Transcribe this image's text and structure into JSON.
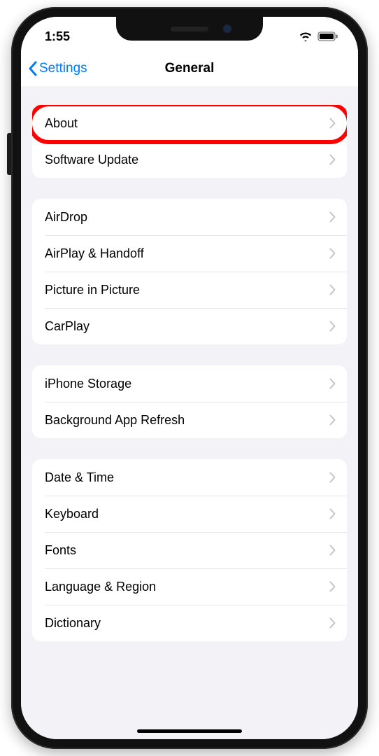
{
  "status": {
    "time": "1:55"
  },
  "nav": {
    "back_label": "Settings",
    "title": "General"
  },
  "groups": [
    {
      "items": [
        {
          "label": "About",
          "highlighted": true
        },
        {
          "label": "Software Update"
        }
      ]
    },
    {
      "items": [
        {
          "label": "AirDrop"
        },
        {
          "label": "AirPlay & Handoff"
        },
        {
          "label": "Picture in Picture"
        },
        {
          "label": "CarPlay"
        }
      ]
    },
    {
      "items": [
        {
          "label": "iPhone Storage"
        },
        {
          "label": "Background App Refresh"
        }
      ]
    },
    {
      "items": [
        {
          "label": "Date & Time"
        },
        {
          "label": "Keyboard"
        },
        {
          "label": "Fonts"
        },
        {
          "label": "Language & Region"
        },
        {
          "label": "Dictionary"
        }
      ]
    }
  ]
}
